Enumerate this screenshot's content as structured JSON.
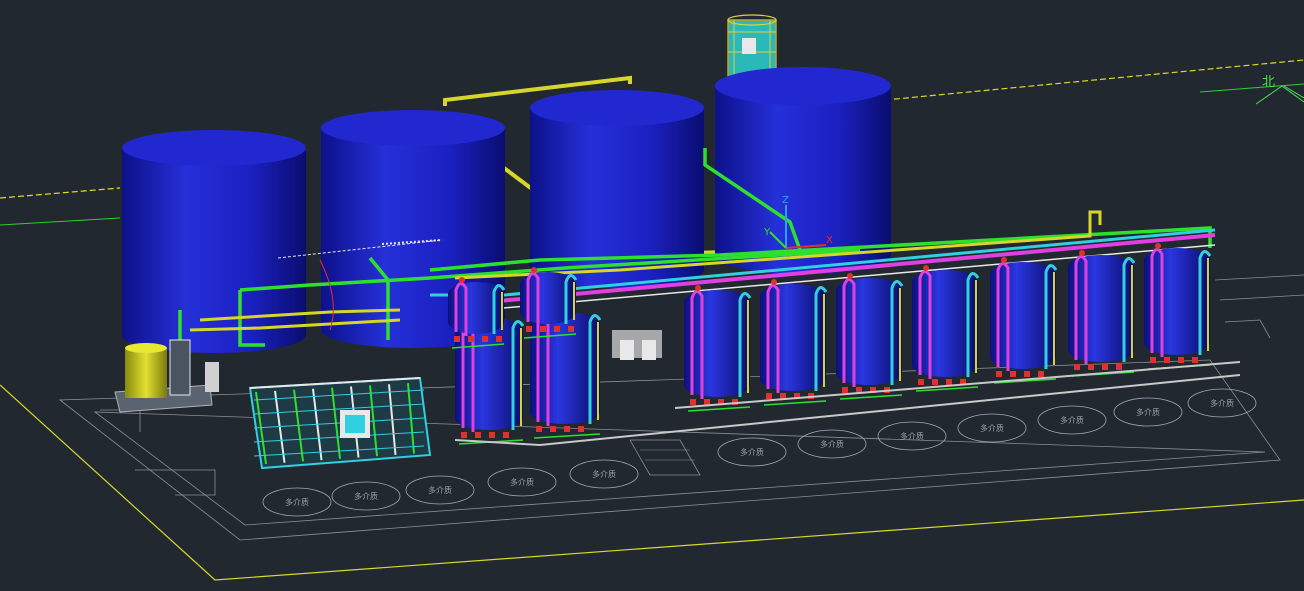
{
  "app": {
    "name": "CAD 3D model viewport",
    "view": "isometric"
  },
  "colors": {
    "background": "#212830",
    "tank": "#1d22c8",
    "pipe_green": "#2ee02e",
    "pipe_yellow": "#d6d62a",
    "pipe_magenta": "#e040e0",
    "pipe_cyan": "#30d0e0",
    "pipe_red": "#e03030",
    "boundary_yellow": "#d8d82a",
    "boundary_green": "#2ed02e",
    "foundation_line": "#c8c8c8"
  },
  "annotations": {
    "north_marker": "北",
    "foundation_labels": [
      "多介质",
      "多介质",
      "多介质",
      "多介质",
      "多介质",
      "多介质",
      "多介质",
      "多介质",
      "多介质",
      "多介质",
      "多介质",
      "多介质"
    ]
  },
  "ucs_icon": {
    "axes": [
      "Z",
      "Y",
      "X"
    ]
  },
  "equipment": {
    "storage_tanks": 4,
    "filter_vessels": 11,
    "dosing_tank": 1,
    "membrane_skid": 1,
    "tower": 1
  },
  "icons": [
    "ucs-icon",
    "north-arrow-icon"
  ]
}
